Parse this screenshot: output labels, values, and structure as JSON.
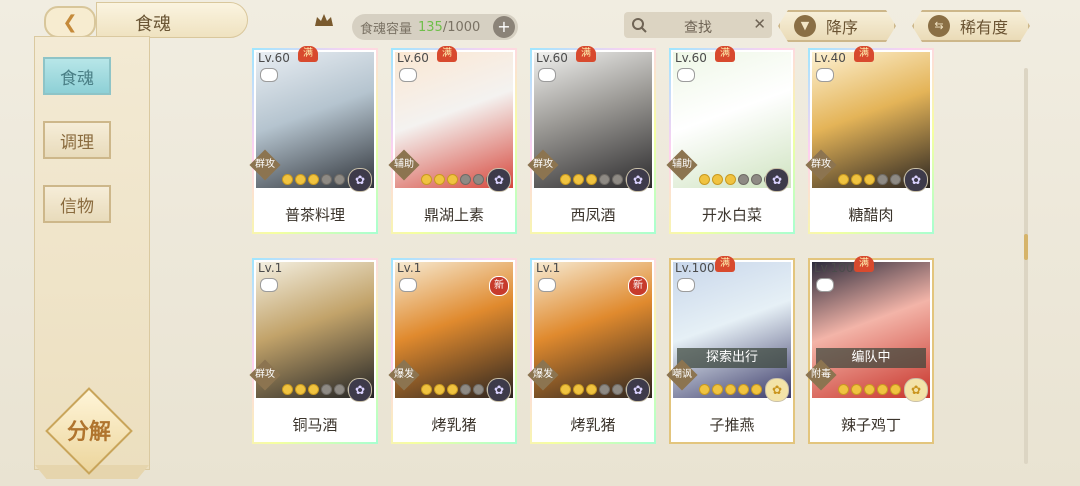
{
  "header": {
    "title": "食魂",
    "capacity_label": "食魂容量",
    "capacity_current": "135",
    "capacity_max": "/1000",
    "search_placeholder": "查找",
    "sort_order": "降序",
    "sort_by": "稀有度"
  },
  "sidebar": {
    "items": [
      {
        "label": "食魂",
        "active": true
      },
      {
        "label": "调理",
        "active": false
      },
      {
        "label": "信物",
        "active": false
      }
    ],
    "decompose_label": "分解"
  },
  "cards": [
    {
      "level": "Lv.60",
      "full": "满",
      "role": "群攻",
      "name": "普茶料理",
      "stars_filled": 3,
      "stars_total": 6,
      "frame": "rainbow",
      "art": [
        "#e9eef3",
        "#30343a",
        "#b5c4cf"
      ]
    },
    {
      "level": "Lv.60",
      "full": "满",
      "role": "辅助",
      "name": "鼎湖上素",
      "stars_filled": 3,
      "stars_total": 6,
      "frame": "rainbow",
      "art": [
        "#fbe7d2",
        "#d6483d",
        "#f4f2f0"
      ]
    },
    {
      "level": "Lv.60",
      "full": "满",
      "role": "群攻",
      "name": "西凤酒",
      "stars_filled": 3,
      "stars_total": 6,
      "frame": "rainbow",
      "art": [
        "#f1f1ef",
        "#2c2b2d",
        "#9a9894"
      ]
    },
    {
      "level": "Lv.60",
      "full": "满",
      "role": "辅助",
      "name": "开水白菜",
      "stars_filled": 3,
      "stars_total": 6,
      "frame": "rainbow",
      "art": [
        "#eef7e6",
        "#cfe3c0",
        "#ffffff"
      ]
    },
    {
      "level": "Lv.40",
      "full": "满",
      "role": "群攻",
      "name": "糖醋肉",
      "stars_filled": 3,
      "stars_total": 6,
      "frame": "rainbow",
      "art": [
        "#fdf1d2",
        "#2b2521",
        "#e4b458"
      ]
    },
    {
      "level": "Lv.1",
      "role": "群攻",
      "name": "铜马酒",
      "stars_filled": 3,
      "stars_total": 6,
      "frame": "rainbow",
      "art": [
        "#f4f0e2",
        "#232425",
        "#c2a36a"
      ]
    },
    {
      "level": "Lv.1",
      "new": "新",
      "role": "爆发",
      "name": "烤乳猪",
      "stars_filled": 3,
      "stars_total": 6,
      "frame": "rainbow",
      "art": [
        "#f6ead2",
        "#2b2420",
        "#e08a2e"
      ]
    },
    {
      "level": "Lv.1",
      "new": "新",
      "role": "爆发",
      "name": "烤乳猪",
      "stars_filled": 3,
      "stars_total": 6,
      "frame": "rainbow",
      "art": [
        "#f6ead2",
        "#2b2420",
        "#e08a2e"
      ]
    },
    {
      "level": "Lv.100",
      "full": "满",
      "role": "嘲讽",
      "name": "子推燕",
      "status": "探索出行",
      "stars_filled": 5,
      "stars_total": 5,
      "frame": "gold",
      "art": [
        "#c8d6ea",
        "#3d3c6a",
        "#e6f0f6"
      ]
    },
    {
      "level": "Lv.100",
      "full": "满",
      "role": "附毒",
      "name": "辣子鸡丁",
      "status": "编队中",
      "stars_filled": 5,
      "stars_total": 5,
      "frame": "gold",
      "art": [
        "#2c2b3b",
        "#c8342b",
        "#f3b4a8"
      ]
    }
  ]
}
